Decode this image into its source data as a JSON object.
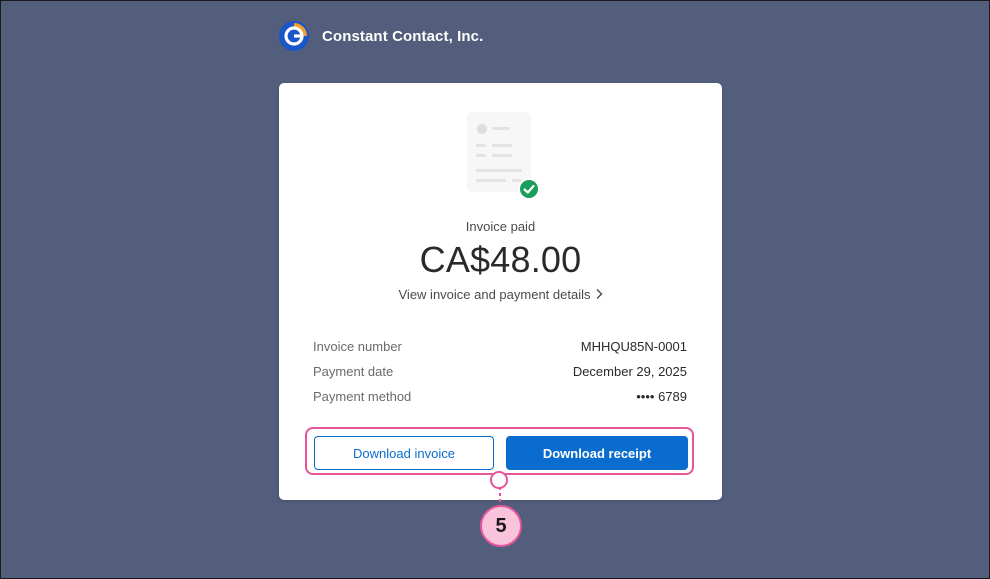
{
  "brand": {
    "name": "Constant Contact, Inc.",
    "logo_icon": "constant-contact-logo"
  },
  "invoice": {
    "status": "Invoice paid",
    "amount": "CA$48.00",
    "details_link": "View invoice and payment details",
    "status_icon": "check-circle-icon"
  },
  "info": [
    {
      "label": "Invoice number",
      "value": "MHHQU85N-0001"
    },
    {
      "label": "Payment date",
      "value": "December 29, 2025"
    },
    {
      "label": "Payment method",
      "value": "•••• 6789"
    }
  ],
  "actions": {
    "download_invoice": "Download invoice",
    "download_receipt": "Download receipt"
  },
  "callout": {
    "number": "5",
    "color": "#e5559b",
    "fill": "#f9c3dc"
  },
  "colors": {
    "background": "#535d7c",
    "accent": "#0a6ccf",
    "success": "#1a9c5b"
  }
}
